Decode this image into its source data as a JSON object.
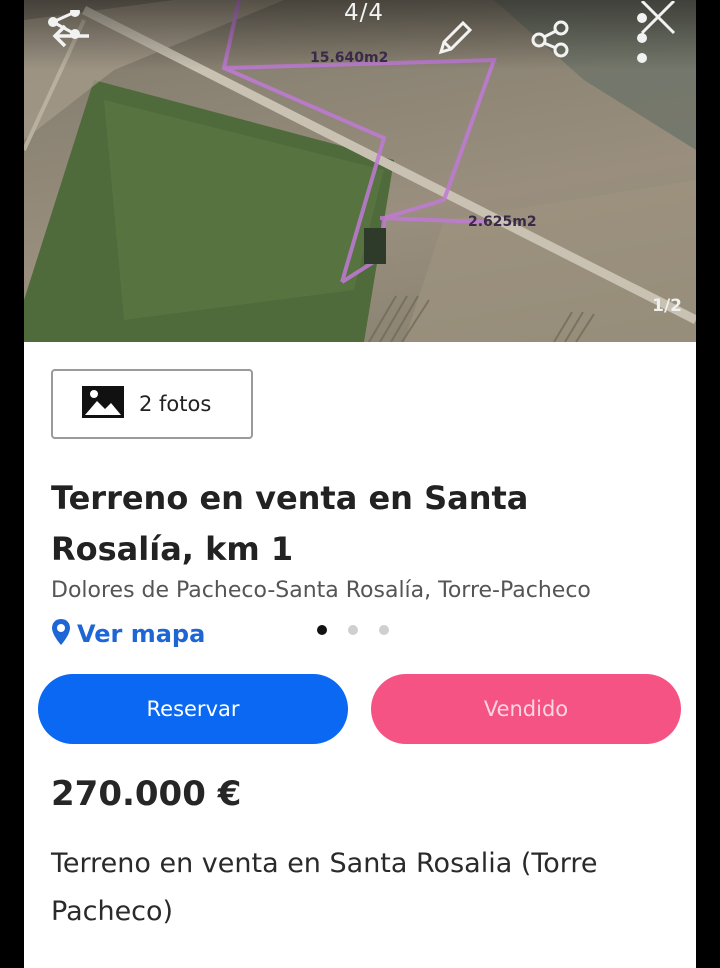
{
  "header": {
    "counter": "4/4",
    "icons": [
      "share-network-icon",
      "back-arrow-icon",
      "edit-pencil-icon",
      "share-icon",
      "more-vertical-icon",
      "close-icon"
    ]
  },
  "image": {
    "area_label_1": "15.640m2",
    "area_label_2": "2.625m2",
    "photo_index": "1/2"
  },
  "listing": {
    "photos_label": "2 fotos",
    "title": "Terreno en venta en Santa Rosalía, km 1",
    "location": "Dolores de Pacheco-Santa Rosalía, Torre-Pacheco",
    "map_link": "Ver mapa",
    "carousel": {
      "count": 3,
      "active": 0
    },
    "reserve_label": "Reservar",
    "sold_label": "Vendido",
    "price": "270.000 €",
    "description": "Terreno en venta en Santa Rosalia (Torre Pacheco)"
  },
  "colors": {
    "primary": "#0a68f2",
    "sold": "#f55383",
    "link": "#1e66d6",
    "plot_outline": "#c07ad6"
  }
}
